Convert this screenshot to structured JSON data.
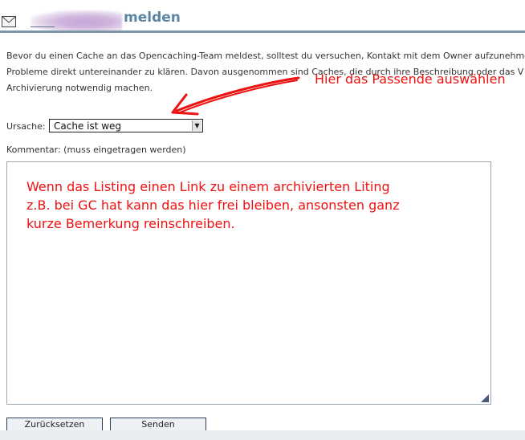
{
  "header": {
    "title_suffix": "melden",
    "mail_icon": "envelope-icon"
  },
  "intro": {
    "lines": [
      "Bevor du einen Cache an das Opencaching-Team meldest, solltest du versuchen, Kontakt mit dem Owner aufzunehmen.",
      "Probleme direkt untereinander zu klären. Davon ausgenommen sind Caches, die durch ihre Beschreibung oder das V",
      "Archivierung notwendig machen."
    ]
  },
  "annotations": {
    "top": "Hier das Passende auswählen",
    "comment_lines": [
      "Wenn das Listing einen Link zu einem archivierten Liting",
      "z.B. bei GC hat kann das hier frei bleiben, ansonsten ganz",
      "kurze Bemerkung reinschreiben."
    ],
    "color": "#ee1111"
  },
  "form": {
    "reason_label": "Ursache:",
    "reason_selected": "Cache ist weg",
    "comment_label": "Kommentar: (muss eingetragen werden)"
  },
  "buttons": {
    "reset_label": "Zurücksetzen",
    "send_label": "Senden"
  },
  "colors": {
    "title": "#5a86a3",
    "header_rule": "#7a95a6"
  }
}
